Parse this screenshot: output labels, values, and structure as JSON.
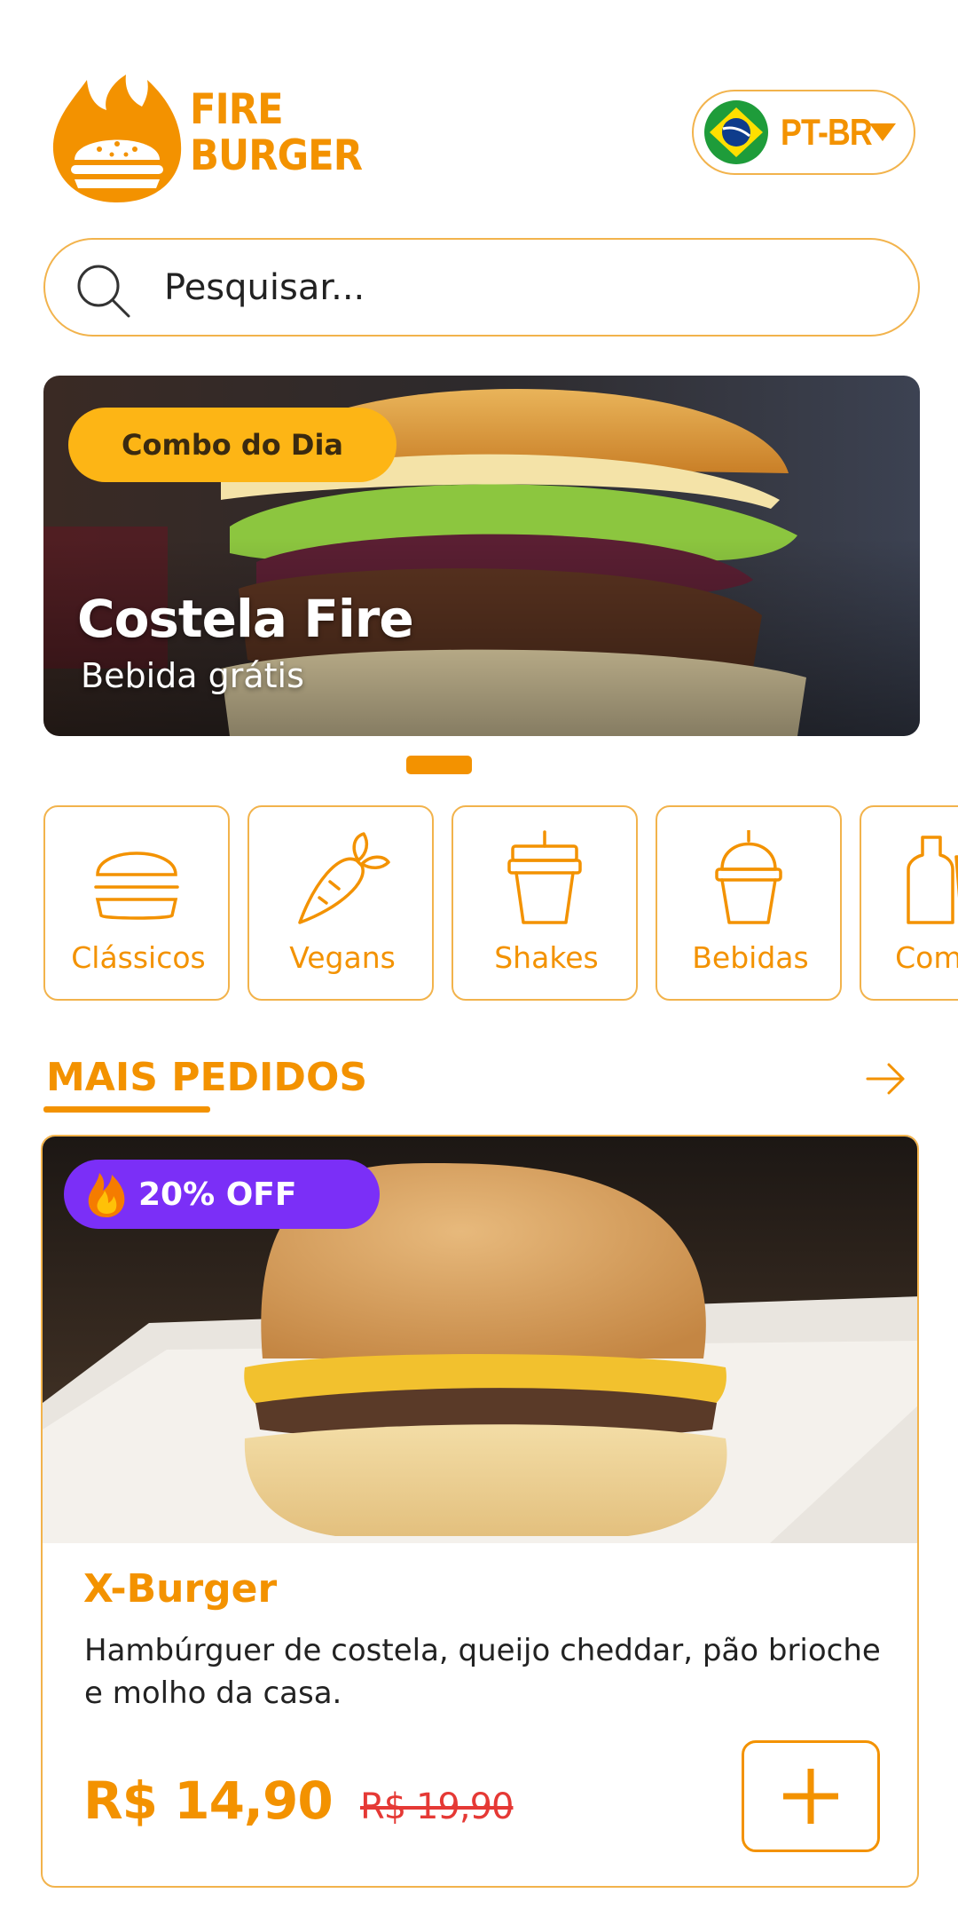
{
  "brand": {
    "line1": "FIRE",
    "line2": "BURGER"
  },
  "language": {
    "code": "PT-BR",
    "flag": "brazil-flag"
  },
  "search": {
    "placeholder": "Pesquisar..."
  },
  "banner": {
    "badge": "Combo do Dia",
    "title": "Costela Fire",
    "subtitle": "Bebida grátis"
  },
  "categories": [
    {
      "label": "Clássicos",
      "icon": "burger-icon"
    },
    {
      "label": "Vegans",
      "icon": "carrot-icon"
    },
    {
      "label": "Shakes",
      "icon": "shake-cup-icon"
    },
    {
      "label": "Bebidas",
      "icon": "drink-cup-icon"
    },
    {
      "label": "Combos",
      "icon": "combo-icon"
    }
  ],
  "section": {
    "title": "MAIS PEDIDOS"
  },
  "product": {
    "badge": "20% OFF",
    "name": "X-Burger",
    "description": "Hambúrguer de costela, queijo cheddar, pão brioche e molho da casa.",
    "price": "R$ 14,90",
    "old_price": "R$ 19,90"
  },
  "colors": {
    "accent": "#F39200",
    "border": "#F2B34C",
    "badge_yellow": "#FDB515",
    "badge_purple": "#7B2FF7",
    "old_price_red": "#E53935"
  }
}
